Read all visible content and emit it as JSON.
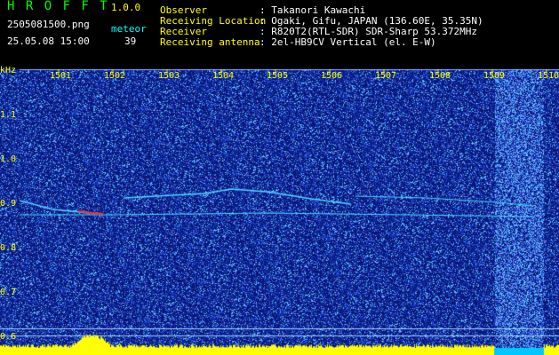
{
  "app": {
    "name": "H R O F F T",
    "version": "1.0.0"
  },
  "file": {
    "name": "2505081500.png",
    "datetime": "25.05.08 15:00"
  },
  "meteor": {
    "label": "meteor",
    "count": "39"
  },
  "info": {
    "rows": [
      {
        "label": "Observer",
        "value": ": Takanori Kawachi"
      },
      {
        "label": "Receiving Location",
        "value": ": Ogaki, Gifu, JAPAN (136.60E, 35.35N)"
      },
      {
        "label": "Receiver",
        "value": ": R820T2(RTL-SDR) SDR-Sharp 53.372MHz"
      },
      {
        "label": "Receiving antenna",
        "value": ": 2el-HB9CV Vertical (el. E-W)"
      }
    ]
  },
  "chart_data": {
    "type": "heatmap",
    "ylabel": "kHz",
    "x_ticks": [
      "1501",
      "1502",
      "1503",
      "1504",
      "1505",
      "1506",
      "1507",
      "1508",
      "1509",
      "1510"
    ],
    "y_ticks": [
      "1.1",
      "1.0",
      "0.9",
      "0.8",
      "0.7",
      "0.6"
    ],
    "colors": {
      "background": "#0a1a6e",
      "noise": "#4a6cff",
      "signal": "#4fd9ff",
      "hot": "#ff3030",
      "level_bar": "#ffff00",
      "level_base": "#00c8ff"
    }
  }
}
